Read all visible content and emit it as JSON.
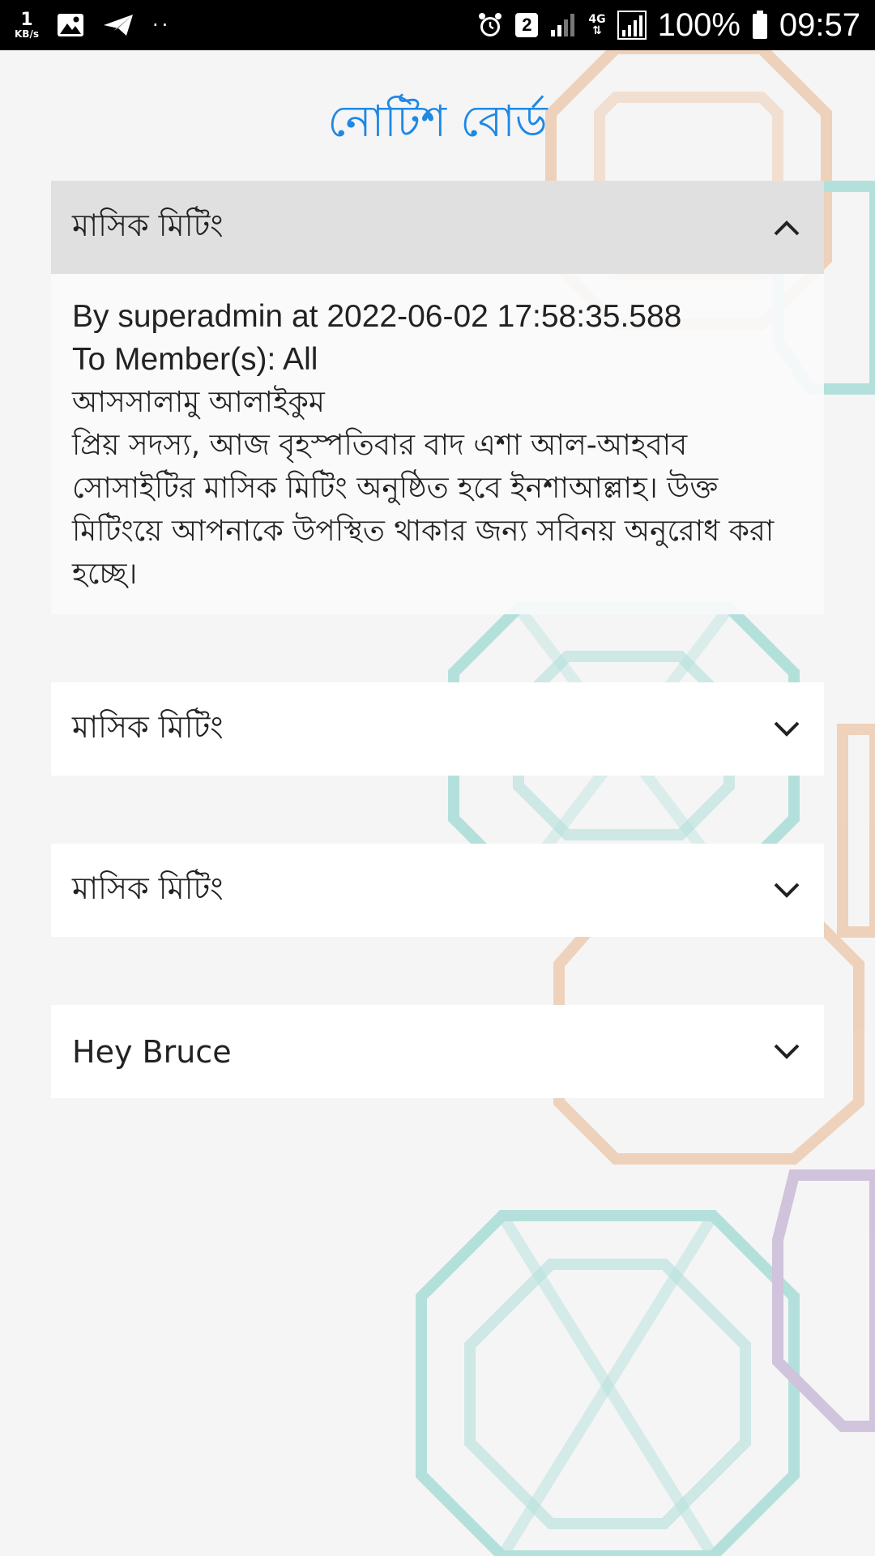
{
  "status_bar": {
    "net_speed_value": "1",
    "net_speed_unit": "KB/s",
    "sim_slot": "2",
    "network_type": "4G",
    "battery_percent": "100%",
    "time": "09:57",
    "dots": "··"
  },
  "page": {
    "title": "নোটিশ বোর্ড"
  },
  "notices": [
    {
      "title": "মাসিক মিটিং",
      "expanded": true,
      "meta_line": "By superadmin at 2022-06-02 17:58:35.588",
      "recipients_line": "To Member(s): All",
      "greeting": "আসসালামু আলাইকুম",
      "body": "প্রিয় সদস্য, আজ বৃহস্পতিবার বাদ এশা আল-আহবাব সোসাইটির মাসিক মিটিং অনুষ্ঠিত হবে ইনশাআল্লাহ। উক্ত মিটিংয়ে আপনাকে উপস্থিত থাকার জন্য সবিনয় অনুরোধ করা হচ্ছে।"
    },
    {
      "title": "মাসিক মিটিং",
      "expanded": false
    },
    {
      "title": "মাসিক মিটিং",
      "expanded": false
    },
    {
      "title": "Hey Bruce",
      "expanded": false
    }
  ],
  "icons": {
    "expanded": "chevron-up-icon",
    "collapsed": "chevron-down-icon"
  },
  "colors": {
    "title_blue": "#1e88e5",
    "header_open_bg": "#e0e0e0",
    "header_closed_bg": "#ffffff",
    "status_bar_bg": "#000000"
  }
}
